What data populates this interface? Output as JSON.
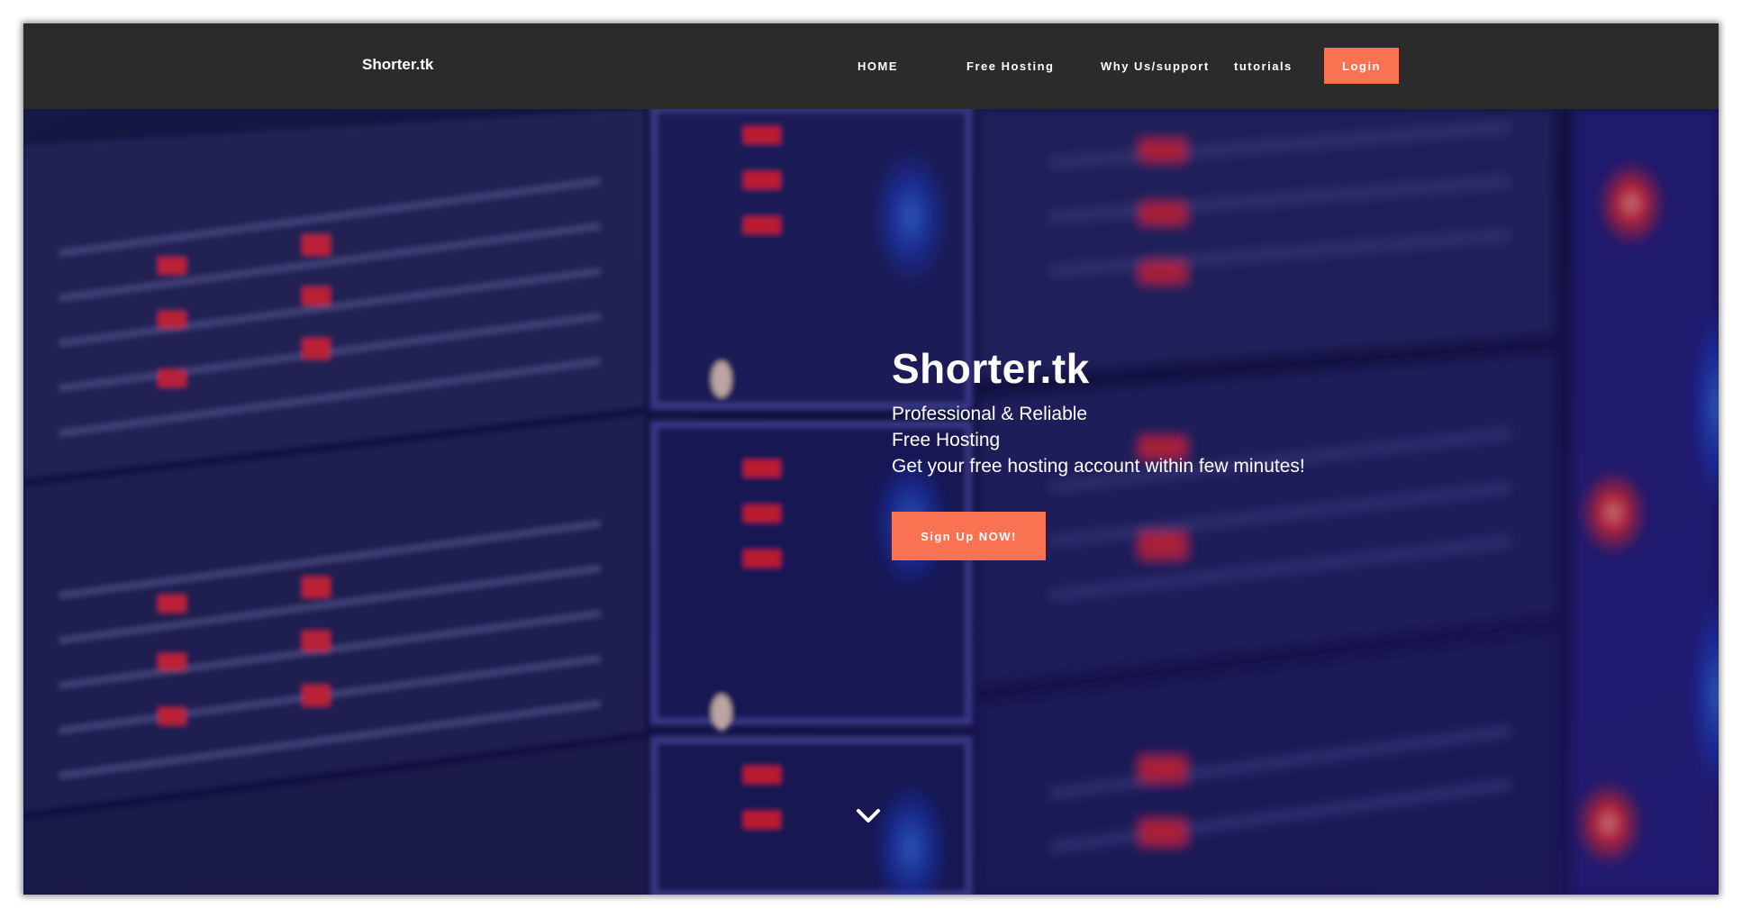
{
  "navbar": {
    "brand": "Shorter.tk",
    "links": [
      {
        "label": "HOME"
      },
      {
        "label": "Free Hosting"
      },
      {
        "label": "Why Us/support"
      },
      {
        "label": "tutorials"
      }
    ],
    "login_label": "Login"
  },
  "hero": {
    "title": "Shorter.tk",
    "lines": [
      "Professional & Reliable",
      "Free Hosting",
      "Get your free hosting account within few minutes!"
    ],
    "signup_label": "Sign Up NOW!",
    "scroll_icon": "chevron-down-icon"
  },
  "colors": {
    "navbar_bg": "#2b2b2b",
    "accent": "#f97352",
    "text": "#ffffff"
  }
}
